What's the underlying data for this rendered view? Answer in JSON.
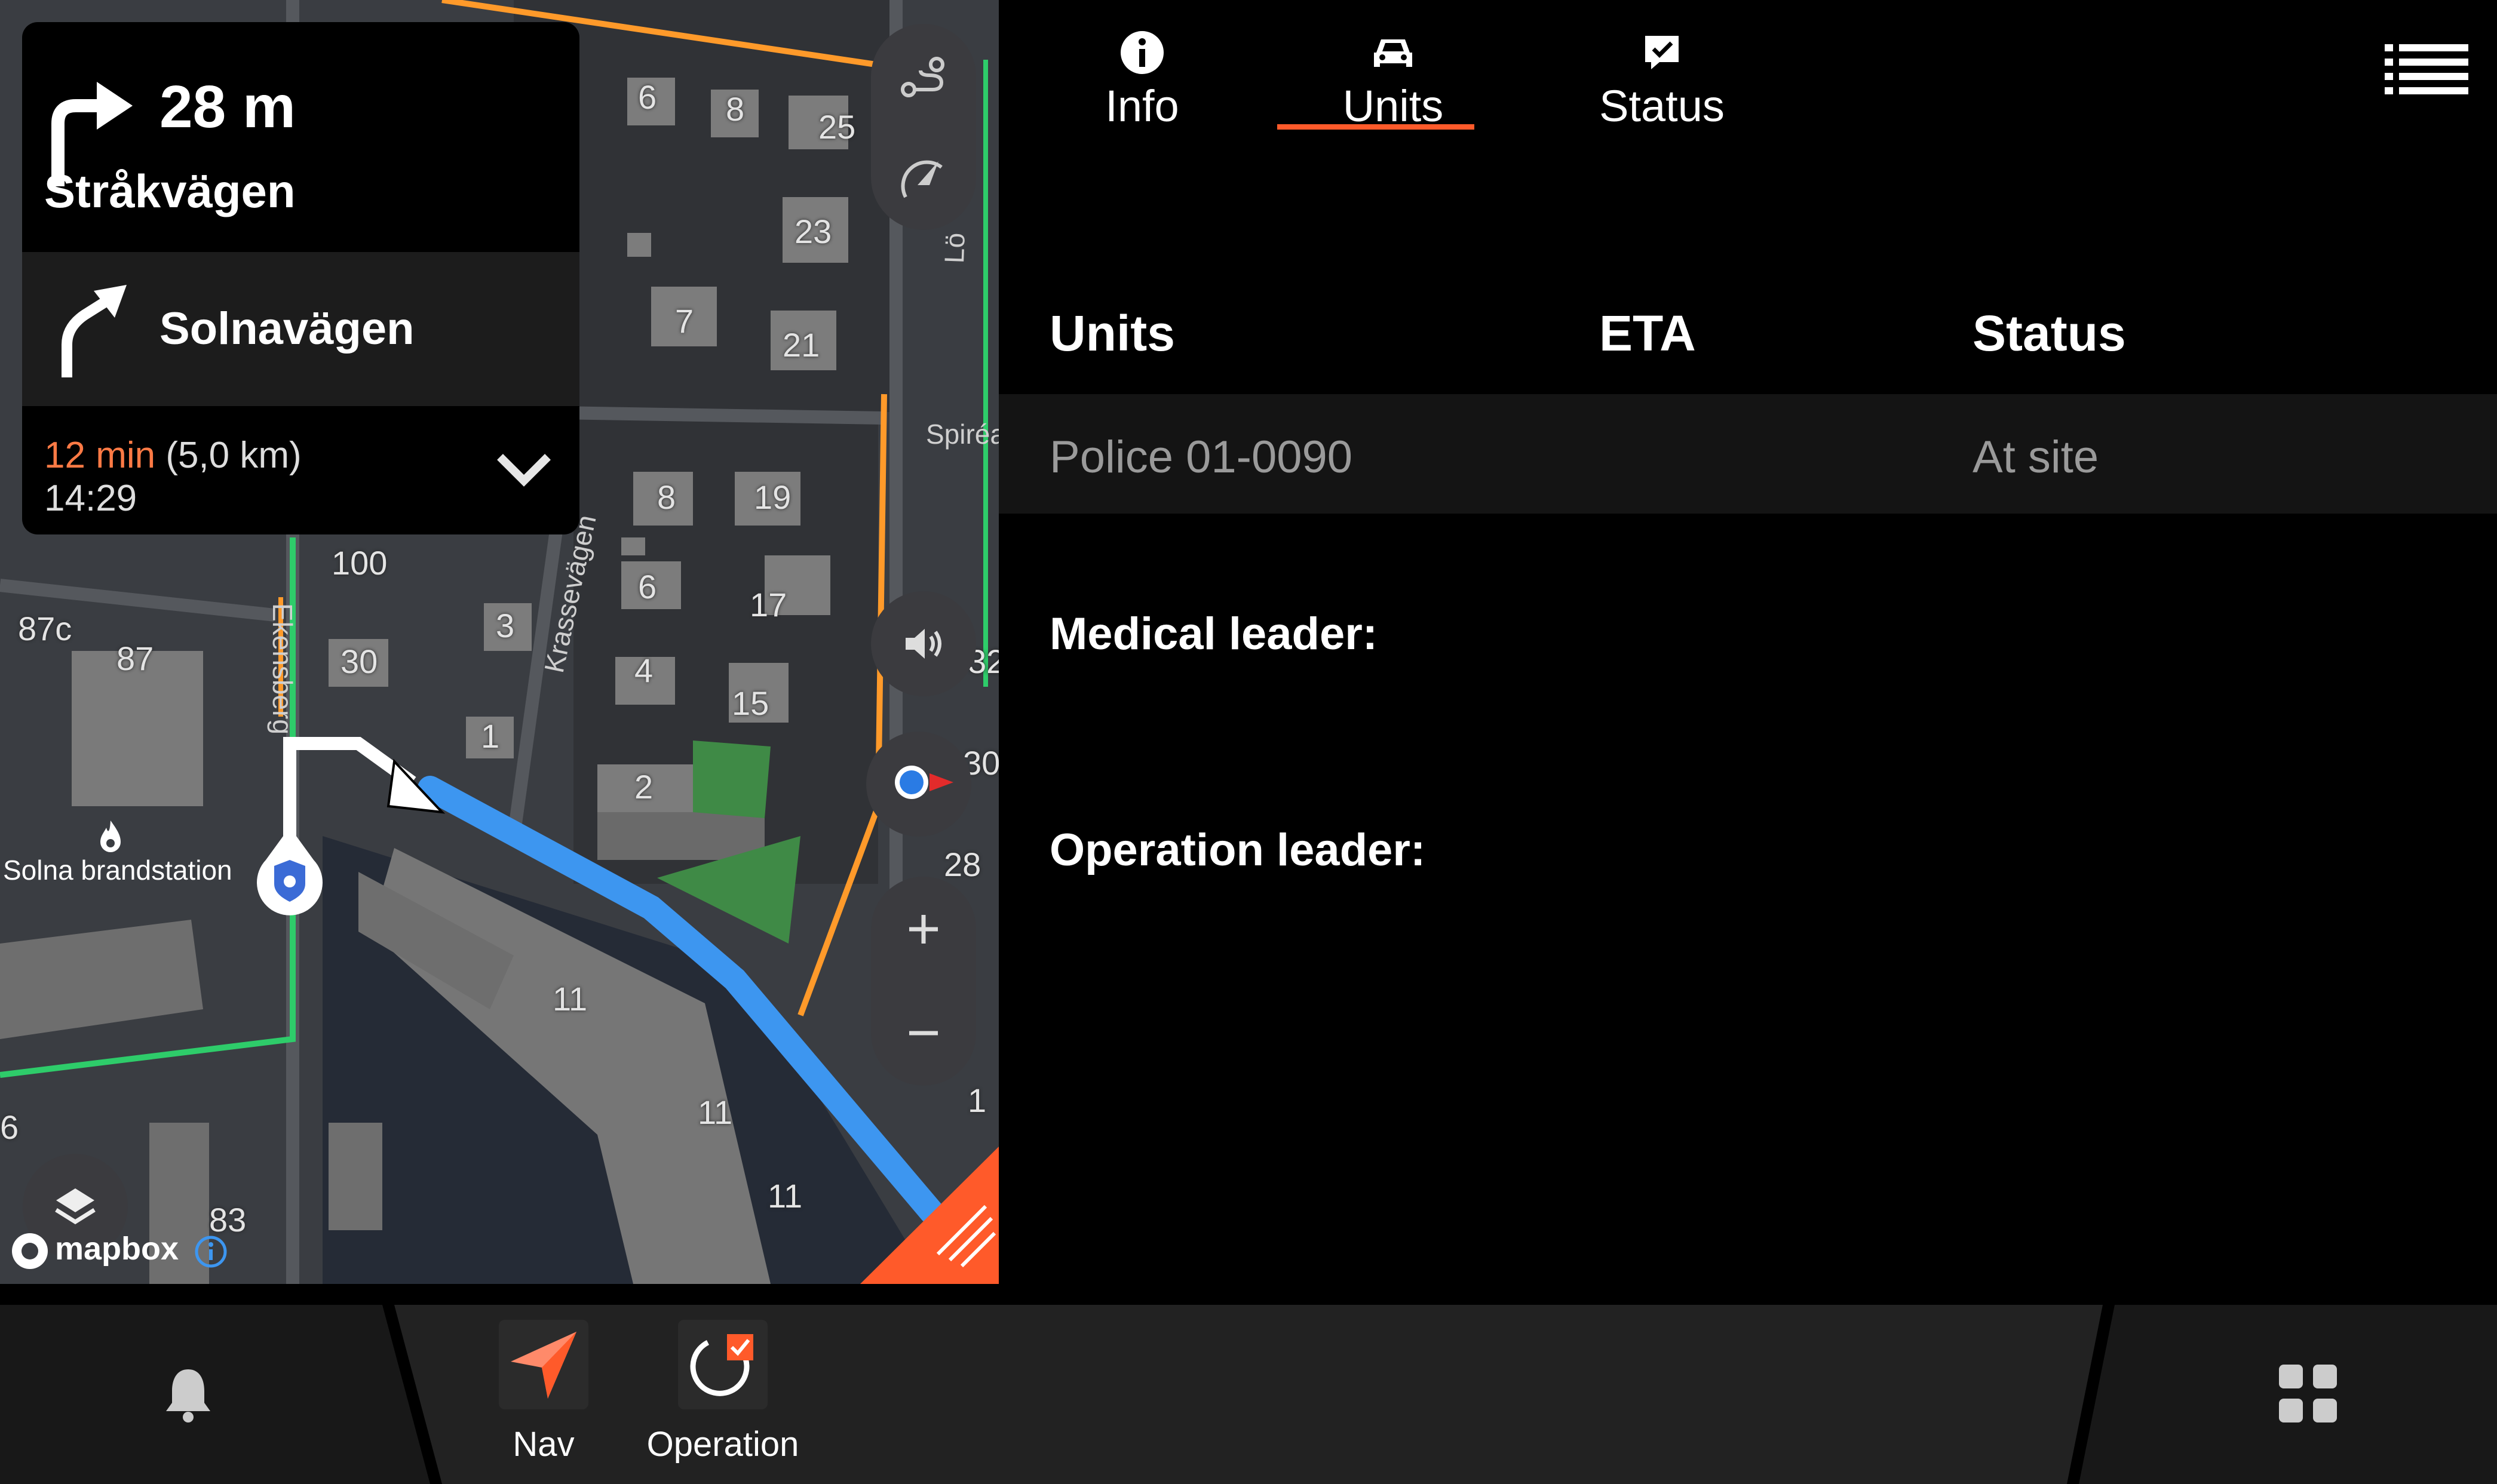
{
  "navigation": {
    "primary_distance": "28 m",
    "primary_road": "Stråkvägen",
    "next_road": "Solnavägen",
    "trip_minutes": "12 min",
    "trip_distance": "(5,0 km)",
    "arrival_time": "14:29"
  },
  "map": {
    "attribution": "mapbox",
    "place_label": "Solna brandstation",
    "street_labels": [
      "Spiréa",
      "Krassevägen",
      "Ekensberg",
      "Lö"
    ],
    "house_numbers": [
      "2",
      "6",
      "8",
      "25",
      "23",
      "7",
      "21",
      "8",
      "19",
      "6",
      "17",
      "4",
      "15",
      "2",
      "100",
      "30",
      "3",
      "1",
      "87c",
      "87",
      "11",
      "11",
      "11",
      "28",
      "30",
      "32",
      "1",
      "6",
      "83"
    ],
    "route_color": "#3d96f0",
    "accent_color": "#ff5a2a"
  },
  "tabs": [
    {
      "label": "Info",
      "icon": "info-icon"
    },
    {
      "label": "Units",
      "icon": "car-icon",
      "active": true
    },
    {
      "label": "Status",
      "icon": "status-check-icon"
    }
  ],
  "units_table": {
    "headers": [
      "Units",
      "ETA",
      "Status"
    ],
    "rows": [
      {
        "unit": "Police 01-0090",
        "eta": "",
        "status": "At site"
      }
    ]
  },
  "leaders": {
    "medical_label": "Medical leader:",
    "operation_label": "Operation leader:"
  },
  "bottom_bar": {
    "apps": [
      {
        "label": "Nav",
        "icon": "navigation-arrow-icon"
      },
      {
        "label": "Operation",
        "icon": "operation-icon"
      }
    ]
  }
}
